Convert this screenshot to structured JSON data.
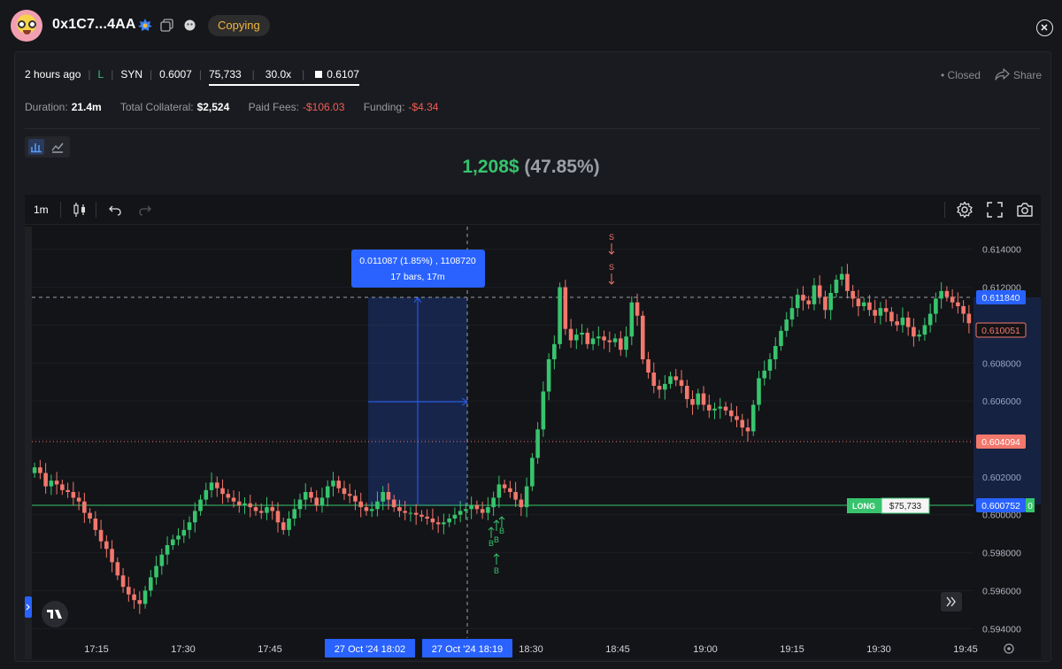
{
  "header": {
    "address": "0x1C7...4AA",
    "copying_label": "Copying"
  },
  "position": {
    "time_ago": "2 hours ago",
    "side": "L",
    "symbol": "SYN",
    "entry_price": "0.6007",
    "size": "75,733",
    "leverage": "30.0x",
    "exit_price": "0.6107",
    "status": "Closed",
    "share_label": "Share"
  },
  "stats": {
    "duration_label": "Duration:",
    "duration": "21.4m",
    "collateral_label": "Total Collateral:",
    "collateral": "$2,524",
    "fees_label": "Paid Fees:",
    "fees": "-$106.03",
    "funding_label": "Funding:",
    "funding": "-$4.34"
  },
  "pnl": {
    "amount": "1,208$",
    "percent": "(47.85%)"
  },
  "toolbar": {
    "timeframe": "1m"
  },
  "colors": {
    "up": "#37c46d",
    "down": "#f2776c",
    "accent": "#2962ff",
    "copying": "#f2b73d"
  },
  "chart_data": {
    "type": "candlestick",
    "y_ticks": [
      "0.614000",
      "0.612000",
      "0.610000",
      "0.608000",
      "0.606000",
      "0.604000",
      "0.602000",
      "0.600000",
      "0.598000",
      "0.596000",
      "0.594000"
    ],
    "ylim": [
      0.5935,
      0.6152
    ],
    "x_ticks": [
      "17:15",
      "17:30",
      "17:45",
      "18:30",
      "18:45",
      "19:00",
      "19:15",
      "19:30",
      "19:45"
    ],
    "x_highlight": [
      "27 Oct '24  18:02",
      "27 Oct '24  18:19"
    ],
    "price_labels": {
      "crosshair": "0.611840",
      "last": "0.610051",
      "liquidation": "0.604094",
      "entry": "0.600752",
      "entry_tag_side": "LONG",
      "entry_tag_size": "$75,733",
      "entry_tag_suffix": "0"
    },
    "measure": {
      "line1": "0.011087 (1.85%) , 1108720",
      "line2": "17 bars, 17m"
    },
    "markers": {
      "buy": "B",
      "sell": "S"
    },
    "closes": [
      0.6025,
      0.6022,
      0.6015,
      0.6018,
      0.6016,
      0.6013,
      0.6012,
      0.6009,
      0.6007,
      0.6001,
      0.5998,
      0.5992,
      0.5986,
      0.5982,
      0.5975,
      0.5968,
      0.5962,
      0.5958,
      0.5955,
      0.5953,
      0.596,
      0.5967,
      0.5973,
      0.5979,
      0.5984,
      0.5987,
      0.5989,
      0.5992,
      0.5996,
      0.6002,
      0.6008,
      0.6013,
      0.6017,
      0.6014,
      0.6011,
      0.6009,
      0.6007,
      0.6005,
      0.6006,
      0.6004,
      0.6002,
      0.6001,
      0.6004,
      0.6002,
      0.5996,
      0.5992,
      0.5998,
      0.6003,
      0.6008,
      0.6012,
      0.6009,
      0.6005,
      0.6009,
      0.6015,
      0.6018,
      0.6014,
      0.6011,
      0.601,
      0.6007,
      0.6004,
      0.6002,
      0.6003,
      0.6007,
      0.6012,
      0.6008,
      0.6004,
      0.6002,
      0.6001,
      0.6001,
      0.6,
      0.5999,
      0.5998,
      0.5996,
      0.5995,
      0.5996,
      0.5998,
      0.6,
      0.6002,
      0.6003,
      0.6005,
      0.6003,
      0.6001,
      0.6004,
      0.6009,
      0.6016,
      0.6014,
      0.6012,
      0.6008,
      0.6004,
      0.6015,
      0.603,
      0.6045,
      0.6065,
      0.6082,
      0.609,
      0.612,
      0.6098,
      0.6092,
      0.6095,
      0.6096,
      0.609,
      0.6093,
      0.6094,
      0.6092,
      0.6091,
      0.6093,
      0.6087,
      0.6094,
      0.6112,
      0.6105,
      0.6082,
      0.6075,
      0.6068,
      0.6066,
      0.6069,
      0.6073,
      0.6071,
      0.6068,
      0.6061,
      0.6058,
      0.6064,
      0.6058,
      0.6055,
      0.6056,
      0.6057,
      0.6055,
      0.6052,
      0.605,
      0.6046,
      0.6044,
      0.6058,
      0.6072,
      0.6076,
      0.6082,
      0.6089,
      0.6097,
      0.6103,
      0.6109,
      0.6116,
      0.6113,
      0.6111,
      0.6121,
      0.6115,
      0.6108,
      0.6117,
      0.6124,
      0.6127,
      0.6118,
      0.6114,
      0.611,
      0.6112,
      0.6108,
      0.6105,
      0.6109,
      0.6107,
      0.6102,
      0.61,
      0.6104,
      0.6099,
      0.6094,
      0.6095,
      0.61,
      0.6106,
      0.6114,
      0.6118,
      0.6115,
      0.6112,
      0.611,
      0.6106,
      0.6101
    ],
    "grid": true,
    "legend": "none"
  }
}
